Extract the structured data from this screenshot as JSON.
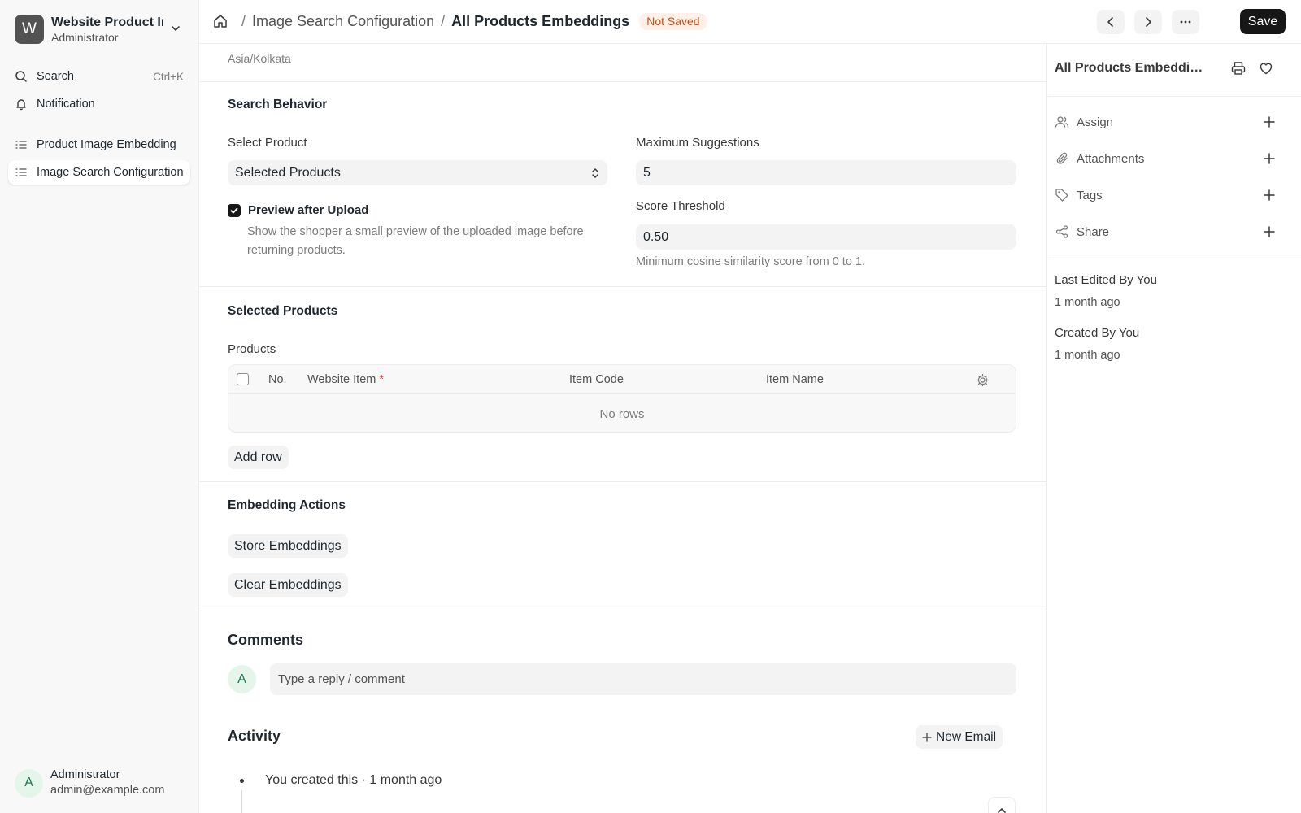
{
  "workspace": {
    "initial": "W",
    "name": "Website Product Image Search",
    "role": "Administrator"
  },
  "sidebar": {
    "search_label": "Search",
    "search_shortcut": "Ctrl+K",
    "notification_label": "Notification",
    "items": [
      {
        "label": "Product Image Embedding"
      },
      {
        "label": "Image Search Configuration"
      }
    ]
  },
  "user": {
    "initial": "A",
    "name": "Administrator",
    "email": "admin@example.com"
  },
  "header": {
    "breadcrumb_parent": "Image Search Configuration",
    "breadcrumb_separator": "/",
    "title": "All Products Embeddings",
    "status": "Not Saved",
    "save_label": "Save"
  },
  "form": {
    "timezone_value": "Asia/Kolkata",
    "search_behavior": {
      "title": "Search Behavior",
      "select_product_label": "Select Product",
      "select_product_value": "Selected Products",
      "preview_label": "Preview after Upload",
      "preview_checked": true,
      "preview_help": "Show the shopper a small preview of the uploaded image before returning products.",
      "max_suggestions_label": "Maximum Suggestions",
      "max_suggestions_value": "5",
      "score_threshold_label": "Score Threshold",
      "score_threshold_value": "0.50",
      "score_threshold_help": "Minimum cosine similarity score from 0 to 1."
    },
    "selected_products": {
      "title": "Selected Products",
      "table_label": "Products",
      "columns": [
        "No.",
        "Website Item",
        "Item Code",
        "Item Name"
      ],
      "required_mark": "*",
      "empty_text": "No rows",
      "add_row_label": "Add row"
    },
    "embedding_actions": {
      "title": "Embedding Actions",
      "store_label": "Store Embeddings",
      "clear_label": "Clear Embeddings"
    }
  },
  "comments": {
    "title": "Comments",
    "avatar_initial": "A",
    "placeholder": "Type a reply / comment"
  },
  "activity": {
    "title": "Activity",
    "new_email_label": "New Email",
    "items": [
      {
        "text": "You created this · 1 month ago"
      }
    ]
  },
  "right_panel": {
    "title": "All Products Embeddings",
    "rows": [
      {
        "label": "Assign"
      },
      {
        "label": "Attachments"
      },
      {
        "label": "Tags"
      },
      {
        "label": "Share"
      }
    ],
    "last_edited": "Last Edited By You",
    "last_edited_time": "1 month ago",
    "created": "Created By You",
    "created_time": "1 month ago"
  },
  "colors": {
    "accent": "#171717",
    "status_bg": "#fff0e8",
    "status_fg": "#c44d14",
    "avatar_bg": "#e4f5e9",
    "avatar_fg": "#16794c"
  }
}
